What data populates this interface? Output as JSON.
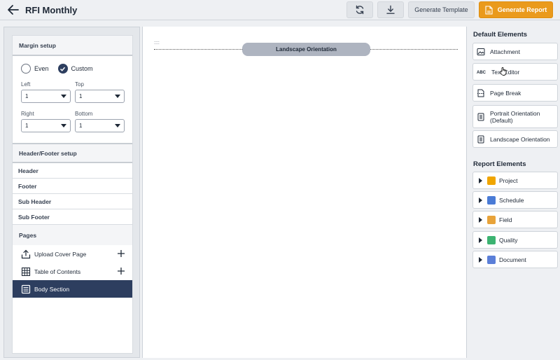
{
  "header": {
    "title": "RFI Monthly",
    "generate_template": "Generate Template",
    "generate_report": "Generate Report"
  },
  "margin": {
    "title": "Margin setup",
    "even": "Even",
    "custom": "Custom",
    "left_label": "Left",
    "left_value": "1",
    "top_label": "Top",
    "top_value": "1",
    "right_label": "Right",
    "right_value": "1",
    "bottom_label": "Bottom",
    "bottom_value": "1"
  },
  "header_footer": {
    "title": "Header/Footer setup",
    "items": [
      "Header",
      "Footer",
      "Sub Header",
      "Sub Footer"
    ]
  },
  "pages": {
    "title": "Pages",
    "items": [
      "Upload Cover Page",
      "Table of Contents",
      "Body Section"
    ]
  },
  "canvas": {
    "grip": "::::",
    "orientation_label": "Landscape Orientation"
  },
  "default_elements": {
    "title": "Default Elements",
    "items": [
      "Attachment",
      "Text Editor",
      "Page Break",
      "Portrait Orientation (Default)",
      "Landscape Orientation"
    ]
  },
  "report_elements": {
    "title": "Report Elements",
    "items": [
      "Project",
      "Schedule",
      "Field",
      "Quality",
      "Document"
    ]
  },
  "colors": {
    "accent": "#ea9a1c",
    "active_nav": "#2d3e5f"
  }
}
